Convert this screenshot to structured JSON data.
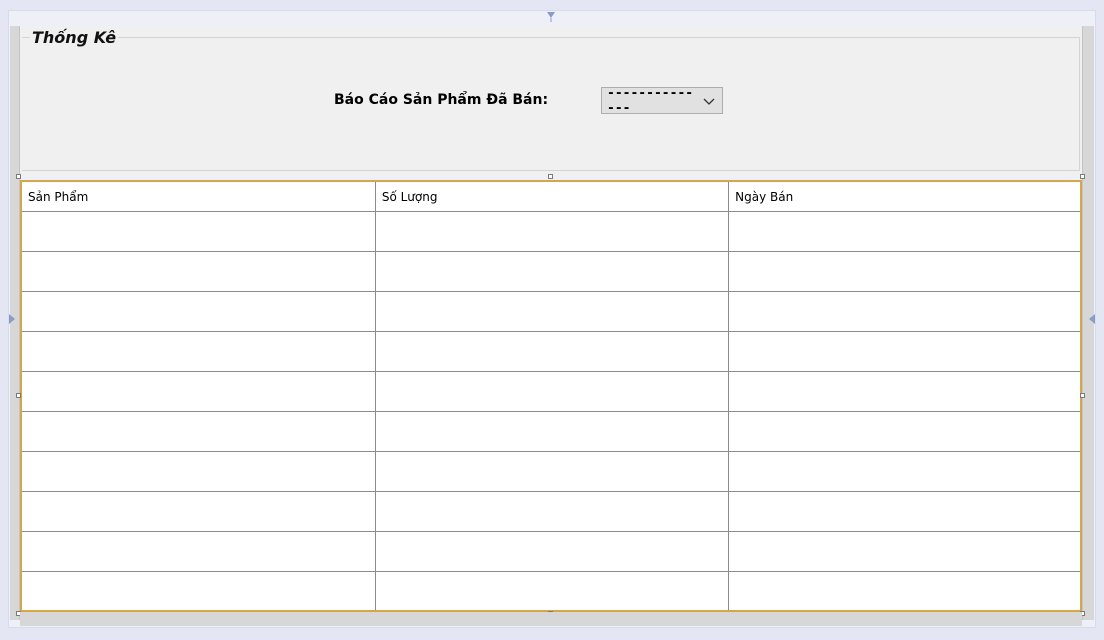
{
  "group": {
    "title": "Thống Kê"
  },
  "report": {
    "label": "Báo Cáo Sản Phẩm Đã Bán:",
    "selected_value": "--------------"
  },
  "grid": {
    "columns": [
      "Sản Phẩm",
      "Số Lượng",
      "Ngày Bán"
    ],
    "row_count": 10
  },
  "icons": {
    "dropdown": "chevron-down-icon",
    "top_marker": "arrow-down-icon",
    "side_marker": "arrow-icon"
  },
  "colors": {
    "selection_border": "#d7a64a",
    "panel_background": "#f0f0f0",
    "frame_background": "#e4e7f3"
  }
}
